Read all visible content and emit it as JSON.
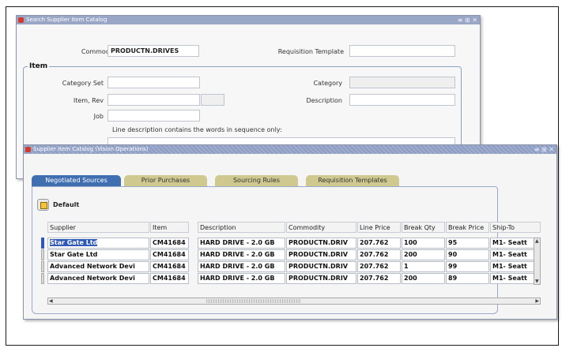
{
  "search_window": {
    "title": "Search Supplier Item Catalog",
    "controls": "≡ ⊞ ✕",
    "commodity_label": "Commodity",
    "commodity_value": "PRODUCTN.DRIVES",
    "requisition_template_label": "Requisition Template",
    "requisition_template_value": "",
    "item_group_title": "Item",
    "category_set_label": "Category Set",
    "category_label": "Category",
    "item_rev_label": "Item, Rev",
    "description_label": "Description",
    "job_label": "Job",
    "line_description_note": "Line description contains the words in sequence only:"
  },
  "catalog_window": {
    "title": "Supplier Item Catalog (Vision Operations)",
    "controls": "≡ ⊞ ✕",
    "tabs": [
      {
        "label": "Negotiated Sources",
        "active": true
      },
      {
        "label": "Prior Purchases",
        "active": false
      },
      {
        "label": "Sourcing Rules",
        "active": false
      },
      {
        "label": "Requisition Templates",
        "active": false
      }
    ],
    "default_label": "Default",
    "columns": [
      "Supplier",
      "Item",
      "Description",
      "Commodity",
      "Line Price",
      "Break Qty",
      "Break Price",
      "Ship-To"
    ],
    "rows": [
      [
        "Star Gate Ltd",
        "CM41684",
        "HARD DRIVE - 2.0 GB",
        "PRODUCTN.DRIV",
        "207.762",
        "100",
        "95",
        "M1- Seatt"
      ],
      [
        "Star Gate Ltd",
        "CM41684",
        "HARD DRIVE - 2.0 GB",
        "PRODUCTN.DRIV",
        "207.762",
        "200",
        "90",
        "M1- Seatt"
      ],
      [
        "Advanced Network Devi",
        "CM41684",
        "HARD DRIVE - 2.0 GB",
        "PRODUCTN.DRIV",
        "207.762",
        "1",
        "99",
        "M1- Seatt"
      ],
      [
        "Advanced Network Devi",
        "CM41684",
        "HARD DRIVE - 2.0 GB",
        "PRODUCTN.DRIV",
        "207.762",
        "200",
        "89",
        "M1- Seatt"
      ]
    ]
  },
  "colors": {
    "titlebar": "#9aa6c6",
    "active_tab": "#3f6fb0",
    "inactive_tab": "#cfc98f",
    "selection": "#2f59b8"
  }
}
